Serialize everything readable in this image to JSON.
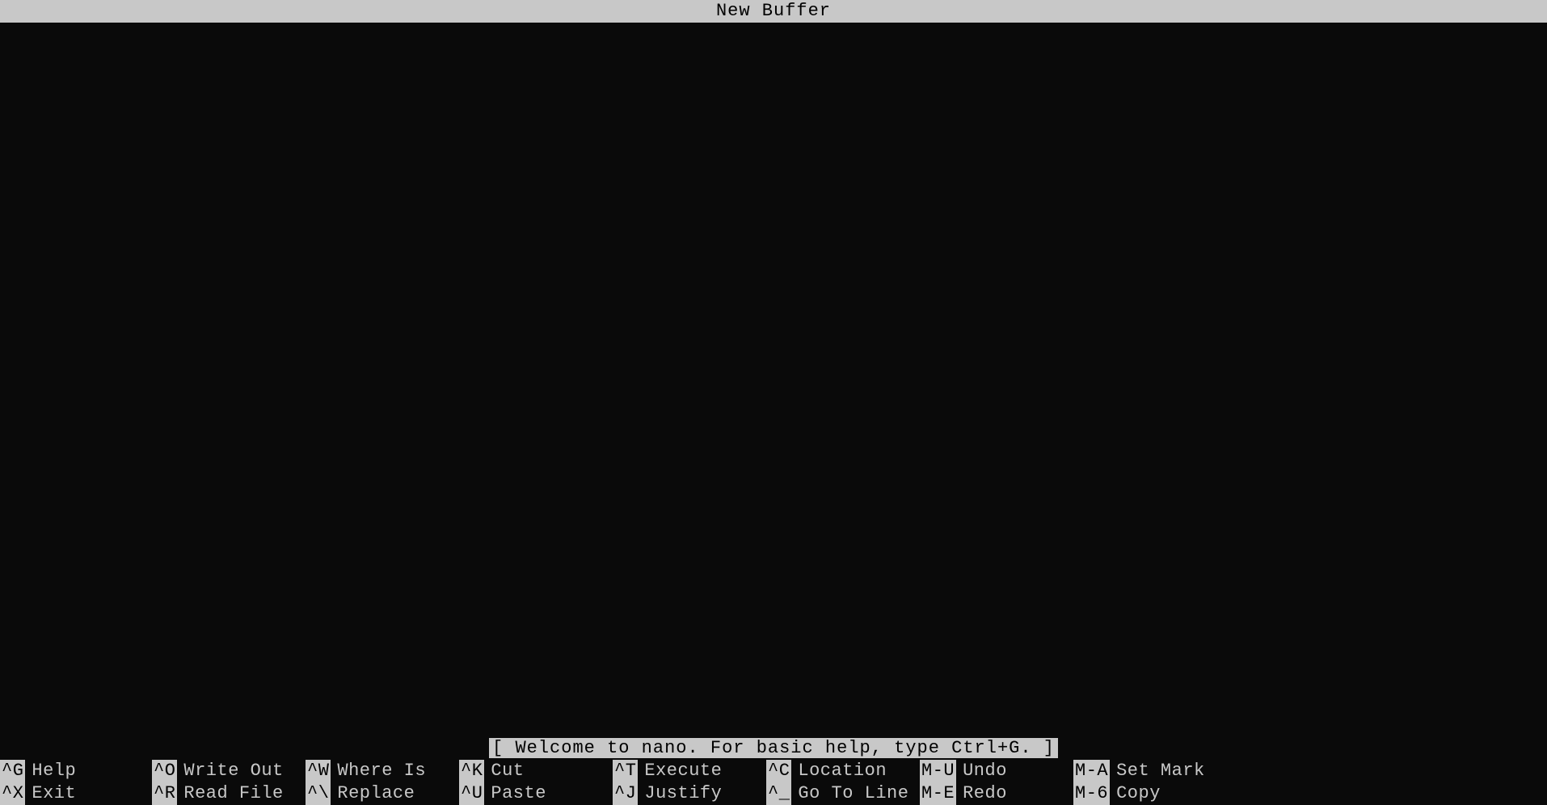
{
  "title": "New Buffer",
  "status_message": "[ Welcome to nano.  For basic help, type Ctrl+G. ]",
  "shortcuts": {
    "row1": [
      {
        "key": "^G",
        "label": "Help"
      },
      {
        "key": "^O",
        "label": "Write Out"
      },
      {
        "key": "^W",
        "label": "Where Is"
      },
      {
        "key": "^K",
        "label": "Cut"
      },
      {
        "key": "^T",
        "label": "Execute"
      },
      {
        "key": "^C",
        "label": "Location"
      },
      {
        "key": "M-U",
        "label": "Undo"
      },
      {
        "key": "M-A",
        "label": "Set Mark"
      }
    ],
    "row2": [
      {
        "key": "^X",
        "label": "Exit"
      },
      {
        "key": "^R",
        "label": "Read File"
      },
      {
        "key": "^\\",
        "label": "Replace"
      },
      {
        "key": "^U",
        "label": "Paste"
      },
      {
        "key": "^J",
        "label": "Justify"
      },
      {
        "key": "^_",
        "label": "Go To Line"
      },
      {
        "key": "M-E",
        "label": "Redo"
      },
      {
        "key": "M-6",
        "label": "Copy"
      }
    ]
  }
}
